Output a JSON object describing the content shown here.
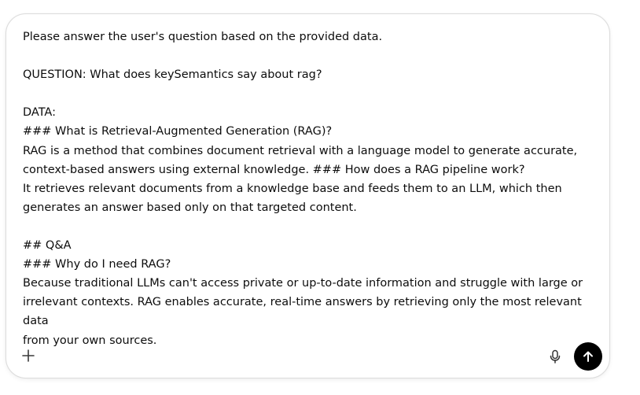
{
  "composer": {
    "text_lines": [
      "Please answer the user's question based on the provided data.",
      "",
      "QUESTION: What does keySemantics say about rag?",
      "",
      "DATA:",
      "### What is Retrieval-Augmented Generation (RAG)?",
      "RAG is a method that combines document retrieval with a language model to generate accurate,",
      "context-based answers using external knowledge. ### How does a RAG pipeline work?",
      "It retrieves relevant documents from a knowledge base and feeds them to an LLM, which then",
      "generates an answer based only on that targeted content.",
      "",
      "## Q&A",
      "### Why do I need RAG?",
      "Because traditional LLMs can't access private or up-to-date information and struggle with large or",
      "irrelevant contexts. RAG enables accurate, real-time answers by retrieving only the most relevant data",
      "from your own sources."
    ]
  },
  "icons": {
    "add": "plus-icon",
    "mic": "microphone-icon",
    "send": "arrow-up-icon"
  },
  "colors": {
    "text": "#0d0d0d",
    "send_button_bg": "#000000",
    "border": "#dcdcdc"
  }
}
